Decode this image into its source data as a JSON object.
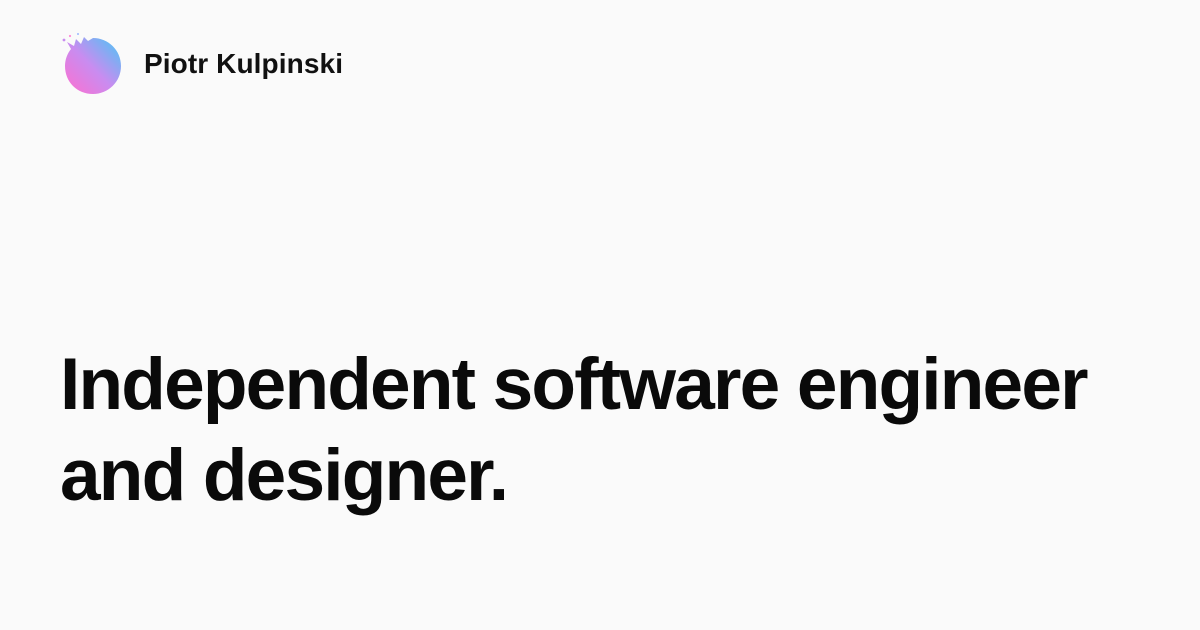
{
  "brand": {
    "name": "Piotr Kulpinski",
    "avatar_icon": "gradient-avatar-icon",
    "avatar_colors": [
      "#ff6fcf",
      "#c98cf0",
      "#45c8f5"
    ]
  },
  "headline": {
    "line1": "Independent software engineer",
    "line2": "and designer."
  },
  "colors": {
    "background": "#fafafa",
    "text": "#0a0a0a"
  }
}
